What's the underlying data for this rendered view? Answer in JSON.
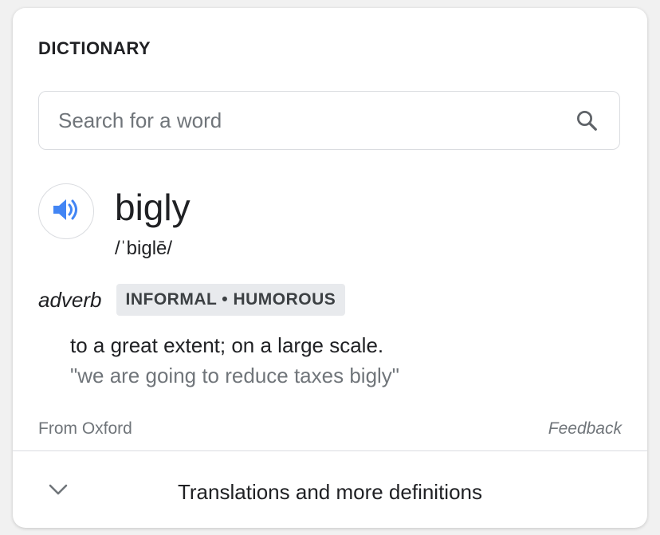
{
  "card": {
    "title": "DICTIONARY"
  },
  "search": {
    "placeholder": "Search for a word",
    "icon": "search-icon"
  },
  "entry": {
    "word": "bigly",
    "phonetic": "/ˈbiglē/",
    "audio_icon": "speaker-icon",
    "part_of_speech": "adverb",
    "labels": "INFORMAL • HUMOROUS",
    "definition": "to a great extent; on a large scale.",
    "example": "\"we are going to reduce taxes bigly\""
  },
  "footer": {
    "source": "From Oxford",
    "feedback": "Feedback"
  },
  "more": {
    "label": "Translations and more definitions",
    "icon": "chevron-down-icon"
  },
  "colors": {
    "accent_blue": "#4285f4",
    "text_primary": "#202124",
    "text_secondary": "#70757a",
    "chip_background": "#e8eaed",
    "border": "#dadce0"
  }
}
